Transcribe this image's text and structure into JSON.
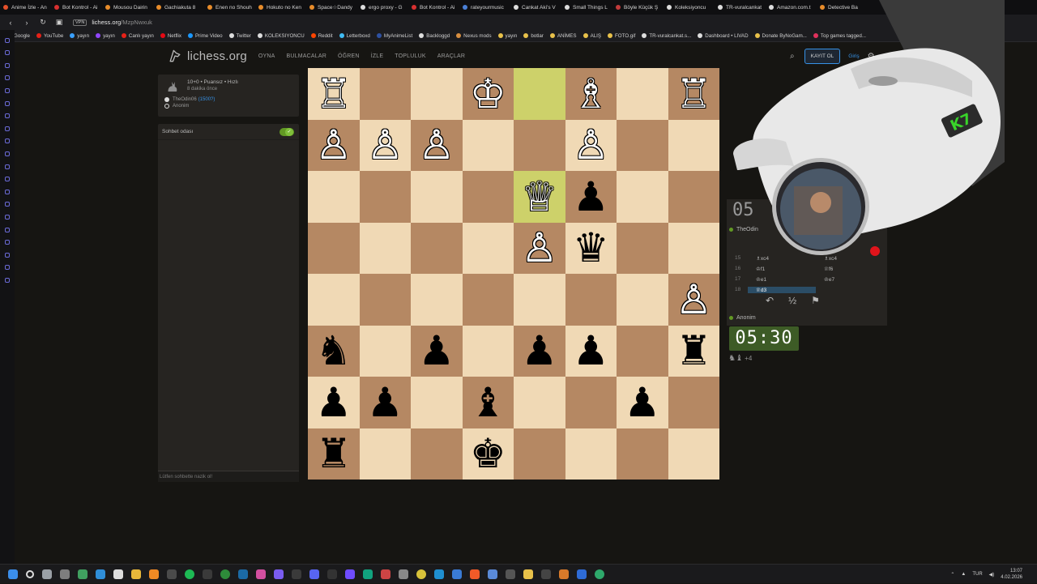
{
  "browser": {
    "tabs": [
      {
        "label": "Anime İzle - An",
        "color": "#e6502a"
      },
      {
        "label": "Bot Kontrol - Ai",
        "color": "#d83030"
      },
      {
        "label": "Mousou Dairin",
        "color": "#e88c2a"
      },
      {
        "label": "Gachiakuta 8",
        "color": "#e88c2a"
      },
      {
        "label": "Enen no Shouh",
        "color": "#e88c2a"
      },
      {
        "label": "Hokuto no Ken",
        "color": "#e88c2a"
      },
      {
        "label": "Space☆Dandy",
        "color": "#e88c2a"
      },
      {
        "label": "ergo proxy - G",
        "color": "#dddddd"
      },
      {
        "label": "Bot Kontrol - Ai",
        "color": "#d83030"
      },
      {
        "label": "rateyourmusic",
        "color": "#4a7fd6"
      },
      {
        "label": "Cankat Aki's V",
        "color": "#dddddd"
      },
      {
        "label": "Small Things L",
        "color": "#dddddd"
      },
      {
        "label": "Böyle Küçük Ş",
        "color": "#c23b3b"
      },
      {
        "label": "Koleksiyoncu",
        "color": "#dddddd"
      },
      {
        "label": "TR-vuralcankat",
        "color": "#dddddd"
      },
      {
        "label": "Amazon.com.t",
        "color": "#dddddd"
      },
      {
        "label": "Detective Ba",
        "color": "#e88c2a"
      }
    ],
    "url_host": "lichess.org",
    "url_path": "/MzpNwxuk",
    "vpn_label": "VPN",
    "bookmarks": [
      {
        "label": "Google",
        "color": "#4285f4"
      },
      {
        "label": "YouTube",
        "color": "#e62117"
      },
      {
        "label": "yayın",
        "color": "#3aa0ff"
      },
      {
        "label": "yayın",
        "color": "#9146ff"
      },
      {
        "label": "Canlı yayın",
        "color": "#e62117"
      },
      {
        "label": "Netflix",
        "color": "#e50914"
      },
      {
        "label": "Prime Video",
        "color": "#1a98ff"
      },
      {
        "label": "Twitter",
        "color": "#dddddd"
      },
      {
        "label": "KOLEKSIYONCU",
        "color": "#dddddd"
      },
      {
        "label": "Reddit",
        "color": "#ff4500"
      },
      {
        "label": "Letterboxd",
        "color": "#40bcf4"
      },
      {
        "label": "MyAnimeList",
        "color": "#2e51a2"
      },
      {
        "label": "Backloggd",
        "color": "#dddddd"
      },
      {
        "label": "Nexus mods",
        "color": "#d98f40"
      },
      {
        "label": "yayın",
        "color": "#e8c14a"
      },
      {
        "label": "botlar",
        "color": "#e8c14a"
      },
      {
        "label": "ANİMES",
        "color": "#e8c14a"
      },
      {
        "label": "ALIŞ",
        "color": "#e8c14a"
      },
      {
        "label": "FOTO.gif",
        "color": "#e8c14a"
      },
      {
        "label": "TR-vuralcankat.s...",
        "color": "#dddddd"
      },
      {
        "label": "Dashboard • LIVAD",
        "color": "#dddddd"
      },
      {
        "label": "Donate ByNoGam...",
        "color": "#e8c14a"
      },
      {
        "label": "Top games tagged...",
        "color": "#e0315c"
      }
    ]
  },
  "lichess": {
    "logo_text": "lichess.org",
    "nav": [
      "OYNA",
      "BULMACALAR",
      "ÖĞREN",
      "İZLE",
      "TOPLULUK",
      "ARAÇLAR"
    ],
    "signup_label": "KAYIT OL",
    "signin_label": "Giriş"
  },
  "game_info": {
    "mode": "10+0 • Puansız • Hızlı",
    "time_ago": "8 dakika önce",
    "white_player": "TheOdin06",
    "white_rating": "(1500?)",
    "black_player": "Anonim"
  },
  "chat": {
    "title": "Sohbet odası",
    "placeholder": "Lütfen sohbette nazik ol!"
  },
  "clocks": {
    "top": "05",
    "top_player": "TheOdin",
    "bottom": "05:30",
    "bottom_player": "Anonim"
  },
  "moves": [
    {
      "num": "15",
      "white": "♗xc4",
      "black": "♗xc4"
    },
    {
      "num": "16",
      "white": "♔f1",
      "black": "♕f6"
    },
    {
      "num": "17",
      "white": "♔e1",
      "black": "♔e7"
    },
    {
      "num": "18",
      "white": "♕d3",
      "black": ""
    }
  ],
  "controls": {
    "back": "↶",
    "draw": "½",
    "resign": "⚑"
  },
  "material": {
    "pieces": "♞♝",
    "diff": "+4"
  },
  "board": {
    "orientation": "black",
    "ranks": [
      [
        "♖w",
        "",
        "",
        "♔w",
        "",
        "♗w",
        "",
        "♖w"
      ],
      [
        "♙w",
        "♙w",
        "♙w",
        "",
        "",
        "♙w",
        "",
        ""
      ],
      [
        "",
        "",
        "",
        "",
        "♕w",
        "♟b",
        "",
        ""
      ],
      [
        "",
        "",
        "",
        "",
        "♙w",
        "♛b",
        "",
        ""
      ],
      [
        "",
        "",
        "",
        "",
        "",
        "",
        "",
        "♙w"
      ],
      [
        "♞b",
        "",
        "♟b",
        "",
        "♟b",
        "♟b",
        "",
        "♜b"
      ],
      [
        "♟b",
        "♟b",
        "",
        "♝b",
        "",
        "",
        "♟b",
        ""
      ],
      [
        "♜b",
        "",
        "",
        "♚b",
        "",
        "",
        "",
        ""
      ]
    ],
    "highlight": [
      [
        0,
        4
      ],
      [
        2,
        4
      ]
    ],
    "colors": {
      "light": "#f0d9b5",
      "dark": "#b58863"
    }
  },
  "taskbar": {
    "lang": "TUR",
    "time": "13:07",
    "date": "4.02.2026"
  },
  "webcam": {
    "badge": "K7"
  }
}
